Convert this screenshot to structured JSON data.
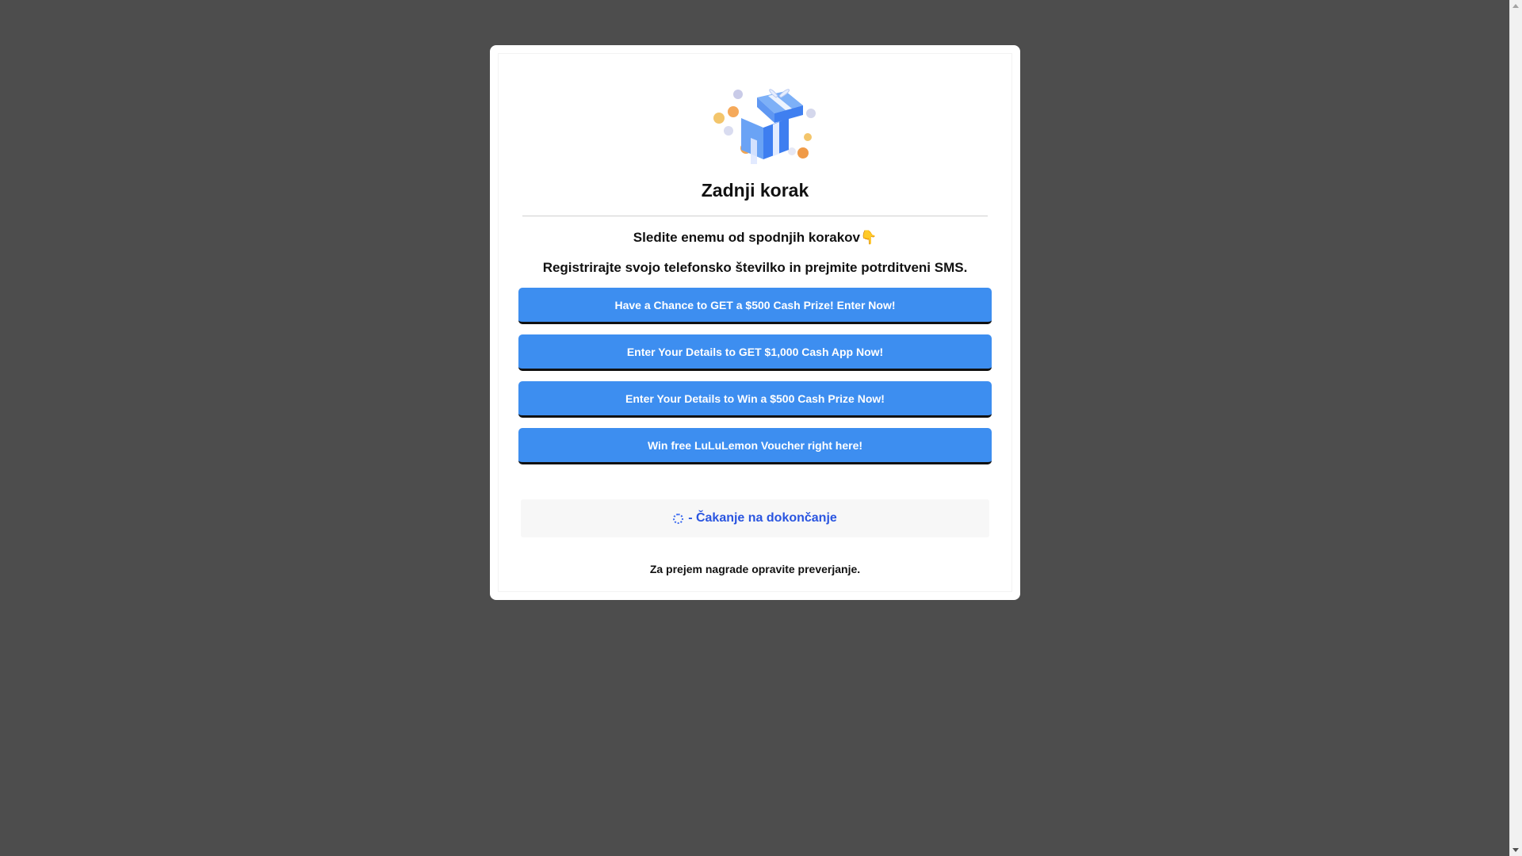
{
  "modal": {
    "title": "Zadnji korak",
    "subtitle": "Sledite enemu od spodnjih korakov👇",
    "instruction": "Registrirajte svojo telefonsko številko in prejmite potrditveni SMS.",
    "gift_icon": "gift-box-with-coins-icon",
    "offers": [
      {
        "label": "Have a Chance to GET a $500 Cash Prize! Enter Now!"
      },
      {
        "label": "Enter Your Details to GET $1,000 Cash App Now!"
      },
      {
        "label": "Enter Your Details to Win a $500 Cash Prize Now!"
      },
      {
        "label": "Win free LuLuLemon Voucher right here!"
      }
    ],
    "status": {
      "icon": "loading-spinner-icon",
      "text": "- Čakanje na dokončanje"
    },
    "footer": "Za prejem nagrade opravite preverjanje."
  },
  "colors": {
    "backdrop": "#4d4d4d",
    "button": "#3d8ef0",
    "status_text": "#2a55e0"
  }
}
